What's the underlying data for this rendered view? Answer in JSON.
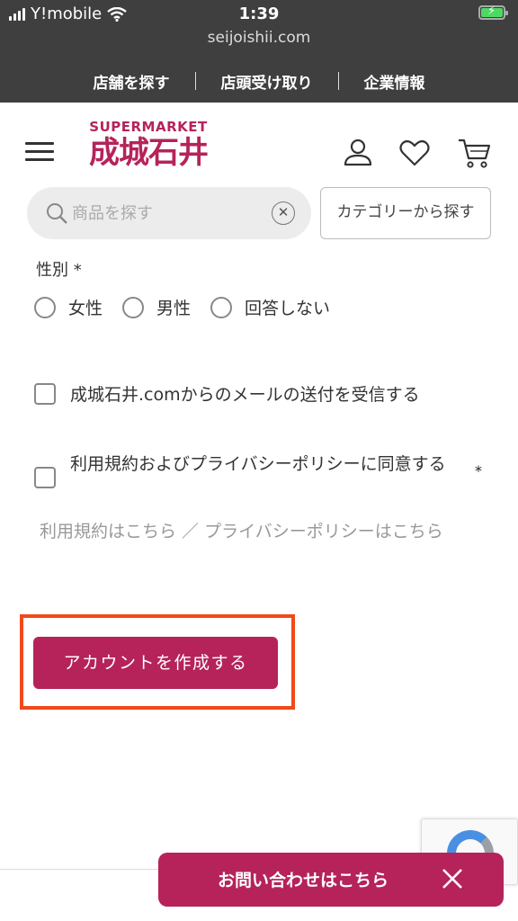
{
  "status": {
    "carrier": "Y!mobile",
    "time": "1:39",
    "url": "seijoishii.com"
  },
  "topnav": {
    "items": [
      {
        "label": "店舗を探す"
      },
      {
        "label": "店頭受け取り"
      },
      {
        "label": "企業情報"
      }
    ]
  },
  "brand": {
    "small": "SUPERMARKET",
    "name": "成城石井",
    "color": "#b5235a"
  },
  "search": {
    "placeholder": "商品を探す",
    "value": "",
    "category_label": "カテゴリーから探す"
  },
  "form": {
    "gender_label": "性別 *",
    "gender_options": [
      {
        "label": "女性",
        "selected": false
      },
      {
        "label": "男性",
        "selected": false
      },
      {
        "label": "回答しない",
        "selected": false
      }
    ],
    "newsletter_label": "成城石井.comからのメールの送付を受信する",
    "newsletter_checked": false,
    "terms_label": "利用規約およびプライバシーポリシーに同意する",
    "terms_required": "*",
    "terms_checked": false,
    "terms_links": "利用規約はこちら ／ プライバシーポリシーはこちら",
    "submit_label": "アカウントを作成する"
  },
  "contact": {
    "label": "お問い合わせはこちら"
  },
  "icons": {
    "menu": "hamburger-menu-icon",
    "account": "user-icon",
    "wishlist": "heart-icon",
    "cart": "cart-icon",
    "search": "search-icon",
    "clear": "clear-icon",
    "close": "close-icon"
  },
  "colors": {
    "accent": "#b5235a",
    "highlight": "#f04a1a",
    "topbar": "#3f3f3f"
  }
}
